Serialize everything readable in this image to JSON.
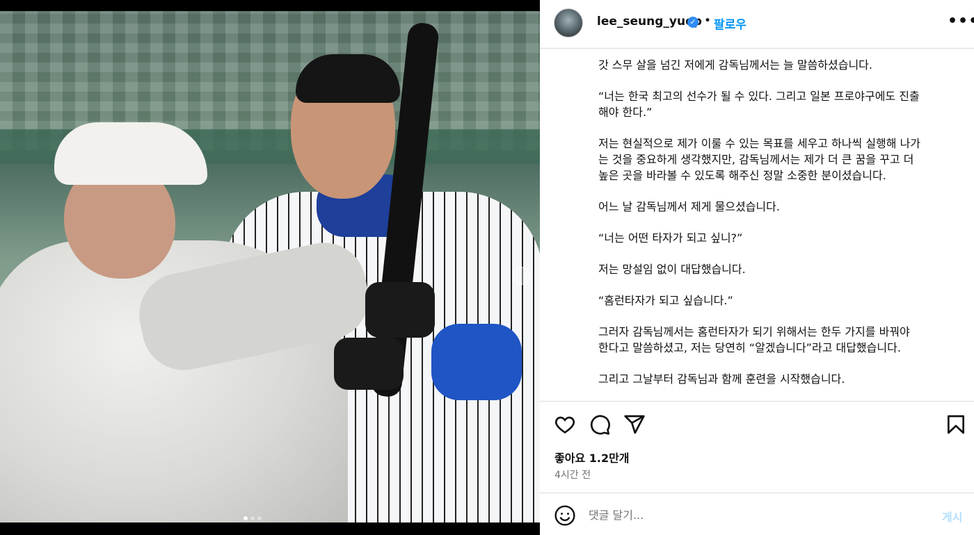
{
  "media": {
    "description_icon": "carousel-next-icon",
    "carousel_dots": 3,
    "active_dot": 0
  },
  "header": {
    "username": "lee_seung_yuop",
    "verified_icon": "verified-badge-icon",
    "separator": "•",
    "follow_label": "팔로우",
    "more_icon": "more-horizontal-icon",
    "more_label": "•••"
  },
  "caption": {
    "paragraphs": [
      "갓 스무 살을 넘긴 저에게 감독님께서는 늘 말씀하셨습니다.",
      "“너는 한국 최고의 선수가 될 수 있다. 그리고 일본 프로야구에도 진출\n해야 한다.”",
      "저는 현실적으로 제가 이룰 수 있는 목표를 세우고 하나씩 실행해 나가\n는 것을 중요하게 생각했지만, 감독님께서는 제가 더 큰 꿈을 꾸고 더\n높은 곳을 바라볼 수 있도록 해주신 정말 소중한 분이셨습니다.",
      "어느 날 감독님께서 제게 물으셨습니다.",
      "“너는 어떤 타자가 되고 싶니?”",
      "저는 망설임 없이 대답했습니다.",
      "“홈런타자가 되고 싶습니다.”",
      "그러자 감독님께서는 홈런타자가 되기 위해서는 한두 가지를 바꿔야\n한다고 말씀하셨고, 저는 당연히 “알겠습니다”라고 대답했습니다.",
      "그리고 그날부터 감독님과 함께 훈련을 시작했습니다."
    ]
  },
  "actions": {
    "like_icon": "heart-icon",
    "comment_icon": "comment-icon",
    "share_icon": "send-icon",
    "save_icon": "bookmark-icon",
    "likes": "좋아요 1.2만개",
    "time": "4시간 전"
  },
  "comment": {
    "emoji_icon": "emoji-icon",
    "placeholder": "댓글 달기...",
    "post_label": "게시"
  }
}
